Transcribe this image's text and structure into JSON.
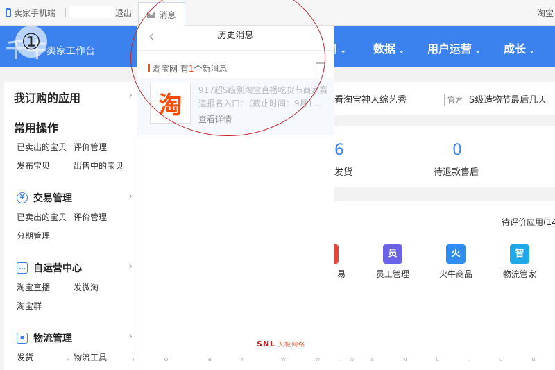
{
  "topbar": {
    "mobile_label": "卖家手机端",
    "logout_label": "退出",
    "message_tab_label": "消息",
    "taobao_label": "淘宝"
  },
  "header": {
    "badge": "①",
    "logo_text": "千牛",
    "seller_label": "卖家工作台",
    "nav": [
      "消",
      "数据",
      "用户运营",
      "成长"
    ],
    "accent_color": "#3b82ef"
  },
  "sidebar": {
    "subscribed_title": "我订购的应用",
    "common_title": "常用操作",
    "common_links": [
      "已卖出的宝贝",
      "评价管理",
      "发布宝贝",
      "出售中的宝贝"
    ],
    "groups": [
      {
        "title": "交易管理",
        "icon": "yen-icon",
        "links": [
          "已卖出的宝贝",
          "评价管理",
          "分期管理"
        ]
      },
      {
        "title": "自运营中心",
        "icon": "chat-icon",
        "links": [
          "淘宝直播",
          "发微淘",
          "淘宝群"
        ]
      },
      {
        "title": "物流管理",
        "icon": "truck-icon",
        "links": [
          "发货",
          "物流工具"
        ]
      }
    ]
  },
  "main": {
    "promo_text_1": "看淘宝神人综艺秀",
    "official_tag": "官方",
    "promo_text_2": "S级造物节最后几天",
    "stats": [
      {
        "value": "6",
        "label": "发货"
      },
      {
        "value": "0",
        "label": "待退款售后"
      }
    ],
    "pending_review_label": "待评价应用(14",
    "apps": [
      {
        "label": "易",
        "color": "#e8453c",
        "glyph": ""
      },
      {
        "label": "员工管理",
        "color": "#6b63e6",
        "glyph": "员"
      },
      {
        "label": "火牛商品",
        "color": "#2f8cf0",
        "glyph": "火"
      },
      {
        "label": "物流管家",
        "color": "#1fa7e8",
        "glyph": "智"
      }
    ]
  },
  "message_panel": {
    "title": "历史消息",
    "source_name": "淘宝网",
    "source_prefix": "有",
    "new_count": "1",
    "source_suffix": "个新消息",
    "card_logo": "淘",
    "card_text": "917超S级别淘宝直播吃货节商家赛道报名入口：（截止时间：9月1...",
    "detail_label": "查看详情",
    "footer_logo": "SNL",
    "footer_sub": "天极网络"
  },
  "watermark": [
    "P O T O",
    "B Y",
    "W W W",
    ". S N L . C N"
  ]
}
